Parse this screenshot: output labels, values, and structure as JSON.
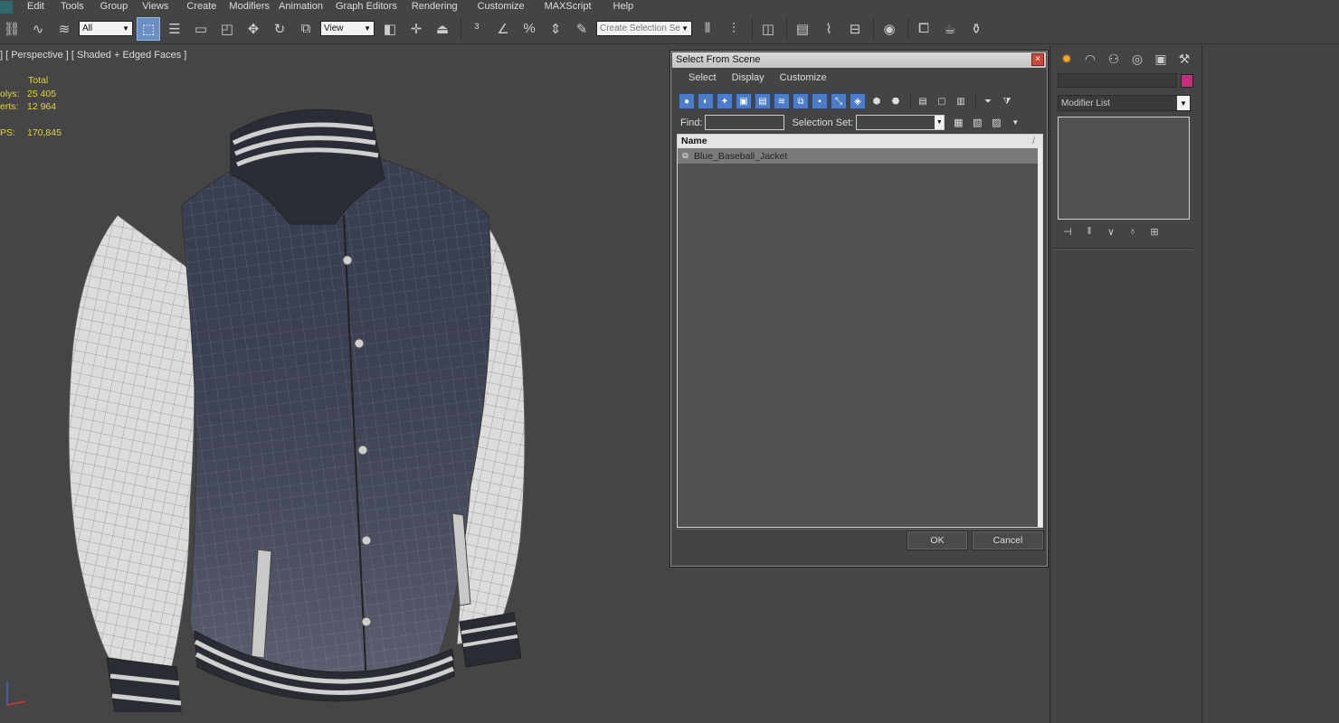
{
  "menubar": {
    "items": [
      "Edit",
      "Tools",
      "Group",
      "Views",
      "Create",
      "Modifiers",
      "Animation",
      "Graph Editors",
      "Rendering",
      "Customize",
      "MAXScript",
      "Help"
    ]
  },
  "toolbar": {
    "filter_value": "All",
    "refcoord_value": "View",
    "selection_set_placeholder": "Create Selection Se"
  },
  "viewport": {
    "label": "] [ Perspective ] [ Shaded + Edged Faces ]",
    "stats": {
      "header": "Total",
      "rows": [
        {
          "label": "olys:",
          "value": "25 405"
        },
        {
          "label": "erts:",
          "value": "12 964"
        },
        {
          "label": "PS:",
          "value": "170,845"
        }
      ]
    }
  },
  "dialog": {
    "title": "Select From Scene",
    "close_glyph": "×",
    "menu": [
      "Select",
      "Display",
      "Customize"
    ],
    "find_label": "Find:",
    "selection_set_label": "Selection Set:",
    "list_header": "Name",
    "sort_glyph": "/",
    "rows": [
      {
        "name": "Blue_Baseball_Jacket"
      }
    ],
    "ok_label": "OK",
    "cancel_label": "Cancel"
  },
  "command_panel": {
    "modifier_list_label": "Modifier List",
    "swatch_color": "#c4307d"
  },
  "colors": {
    "ui_background": "#444444",
    "stats_text": "#e5d23c",
    "selection_blue": "#4c7bc8"
  }
}
